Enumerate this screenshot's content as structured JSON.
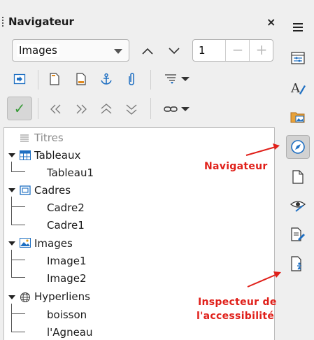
{
  "navigator": {
    "title": "Navigateur",
    "close_label": "×",
    "dropdown_value": "Images",
    "page_number": "1",
    "minus_label": "−",
    "plus_label": "+",
    "check_label": "✓"
  },
  "tree": {
    "headings": "Titres",
    "tables": {
      "label": "Tableaux",
      "children": [
        "Tableau1"
      ]
    },
    "frames": {
      "label": "Cadres",
      "children": [
        "Cadre2",
        "Cadre1"
      ]
    },
    "images": {
      "label": "Images",
      "children": [
        "Image1",
        "Image2"
      ]
    },
    "hyperlinks": {
      "label": "Hyperliens",
      "children": [
        "boisson",
        "l'Agneau"
      ]
    }
  },
  "annotations": {
    "navigator": "Navigateur",
    "accessibility_line1": "Inspecteur de",
    "accessibility_line2": "l'accessibilité"
  },
  "colors": {
    "annotation": "#e0201a",
    "accent_blue": "#1e6fc2",
    "check_green": "#3a9b3a"
  }
}
